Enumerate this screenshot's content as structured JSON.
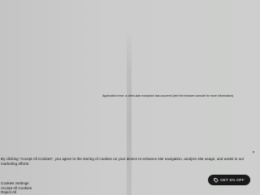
{
  "error": {
    "message": "Application error: a client-side exception has occurred (see the browser console for more information)."
  },
  "cookie_banner": {
    "text": "By clicking “Accept All Cookies”, you agree to the storing of cookies on your device to enhance site navigation, analyze site usage, and assist in our marketing efforts.",
    "settings_label": "Cookies Settings",
    "accept_label": "Accept All Cookies",
    "reject_label": "Reject All",
    "close_glyph": "×"
  },
  "promo": {
    "label": "GET 5% OFF",
    "icon": "tag-icon"
  },
  "colors": {
    "page_bg": "#c9cac9",
    "pill_bg": "#1a1a1a",
    "text": "#111111"
  }
}
